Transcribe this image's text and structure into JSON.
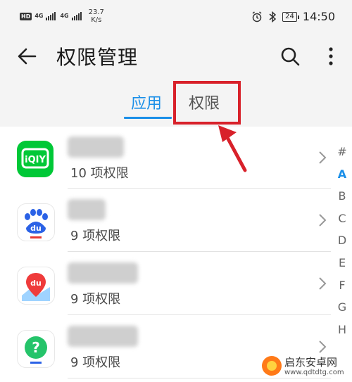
{
  "status_bar": {
    "left_badge": "HD",
    "network_1": "4G",
    "network_2": "4G",
    "speed_value": "23.7",
    "speed_unit": "K/s",
    "battery": "24",
    "time": "14:50",
    "icons": [
      "alarm-icon",
      "bluetooth-icon"
    ]
  },
  "header": {
    "title": "权限管理",
    "back_icon": "arrow-left-icon",
    "search_icon": "search-icon",
    "more_icon": "more-vertical-icon"
  },
  "tabs": [
    {
      "label": "应用",
      "active": true
    },
    {
      "label": "权限",
      "active": false
    }
  ],
  "apps": [
    {
      "icon": "iqiyi-icon",
      "subtitle": "10 项权限"
    },
    {
      "icon": "baidu-icon",
      "subtitle": "9 项权限"
    },
    {
      "icon": "baidu-map-icon",
      "subtitle": "9 项权限"
    },
    {
      "icon": "help-icon",
      "subtitle": "9 项权限"
    }
  ],
  "alpha_index": [
    "#",
    "A",
    "B",
    "C",
    "D",
    "E",
    "F",
    "G",
    "H"
  ],
  "alpha_active": "A",
  "watermark": {
    "text": "启东安卓网",
    "url": "www.qdtdtg.com"
  },
  "colors": {
    "accent": "#1a8fe8",
    "highlight": "#d8212a",
    "iqiyi": "#00c837"
  }
}
